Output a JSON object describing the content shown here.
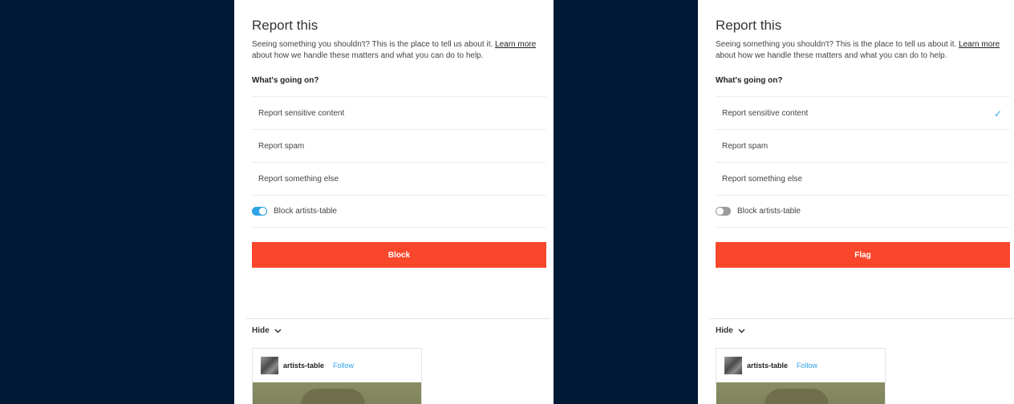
{
  "panels": [
    {
      "title": "Report this",
      "description": "Seeing something you shouldn't? This is the place to tell us about it.",
      "learn_more": "Learn more",
      "description_tail": "about how we handle these matters and what you can do to help.",
      "question": "What's going on?",
      "options": [
        "Report sensitive content",
        "Report spam",
        "Report something else"
      ],
      "selected_option": null,
      "block_label": "Block artists-table",
      "block_toggle": "on",
      "action_label": "Block",
      "hide_label": "Hide",
      "card": {
        "username": "artists-table",
        "follow_label": "Follow"
      }
    },
    {
      "title": "Report this",
      "description": "Seeing something you shouldn't? This is the place to tell us about it.",
      "learn_more": "Learn more",
      "description_tail": "about how we handle these matters and what you can do to help.",
      "question": "What's going on?",
      "options": [
        "Report sensitive content",
        "Report spam",
        "Report something else"
      ],
      "selected_option": "Report sensitive content",
      "check_glyph": "✓",
      "block_label": "Block artists-table",
      "block_toggle": "off",
      "action_label": "Flag",
      "hide_label": "Hide",
      "card": {
        "username": "artists-table",
        "follow_label": "Follow"
      }
    }
  ],
  "colors": {
    "background_dark": "#001935",
    "accent_button": "#f9472c",
    "accent_blue": "#2fa3e6"
  },
  "icons": {
    "hide_chevron": "chevron-down-icon",
    "selected_check": "checkmark-icon"
  }
}
